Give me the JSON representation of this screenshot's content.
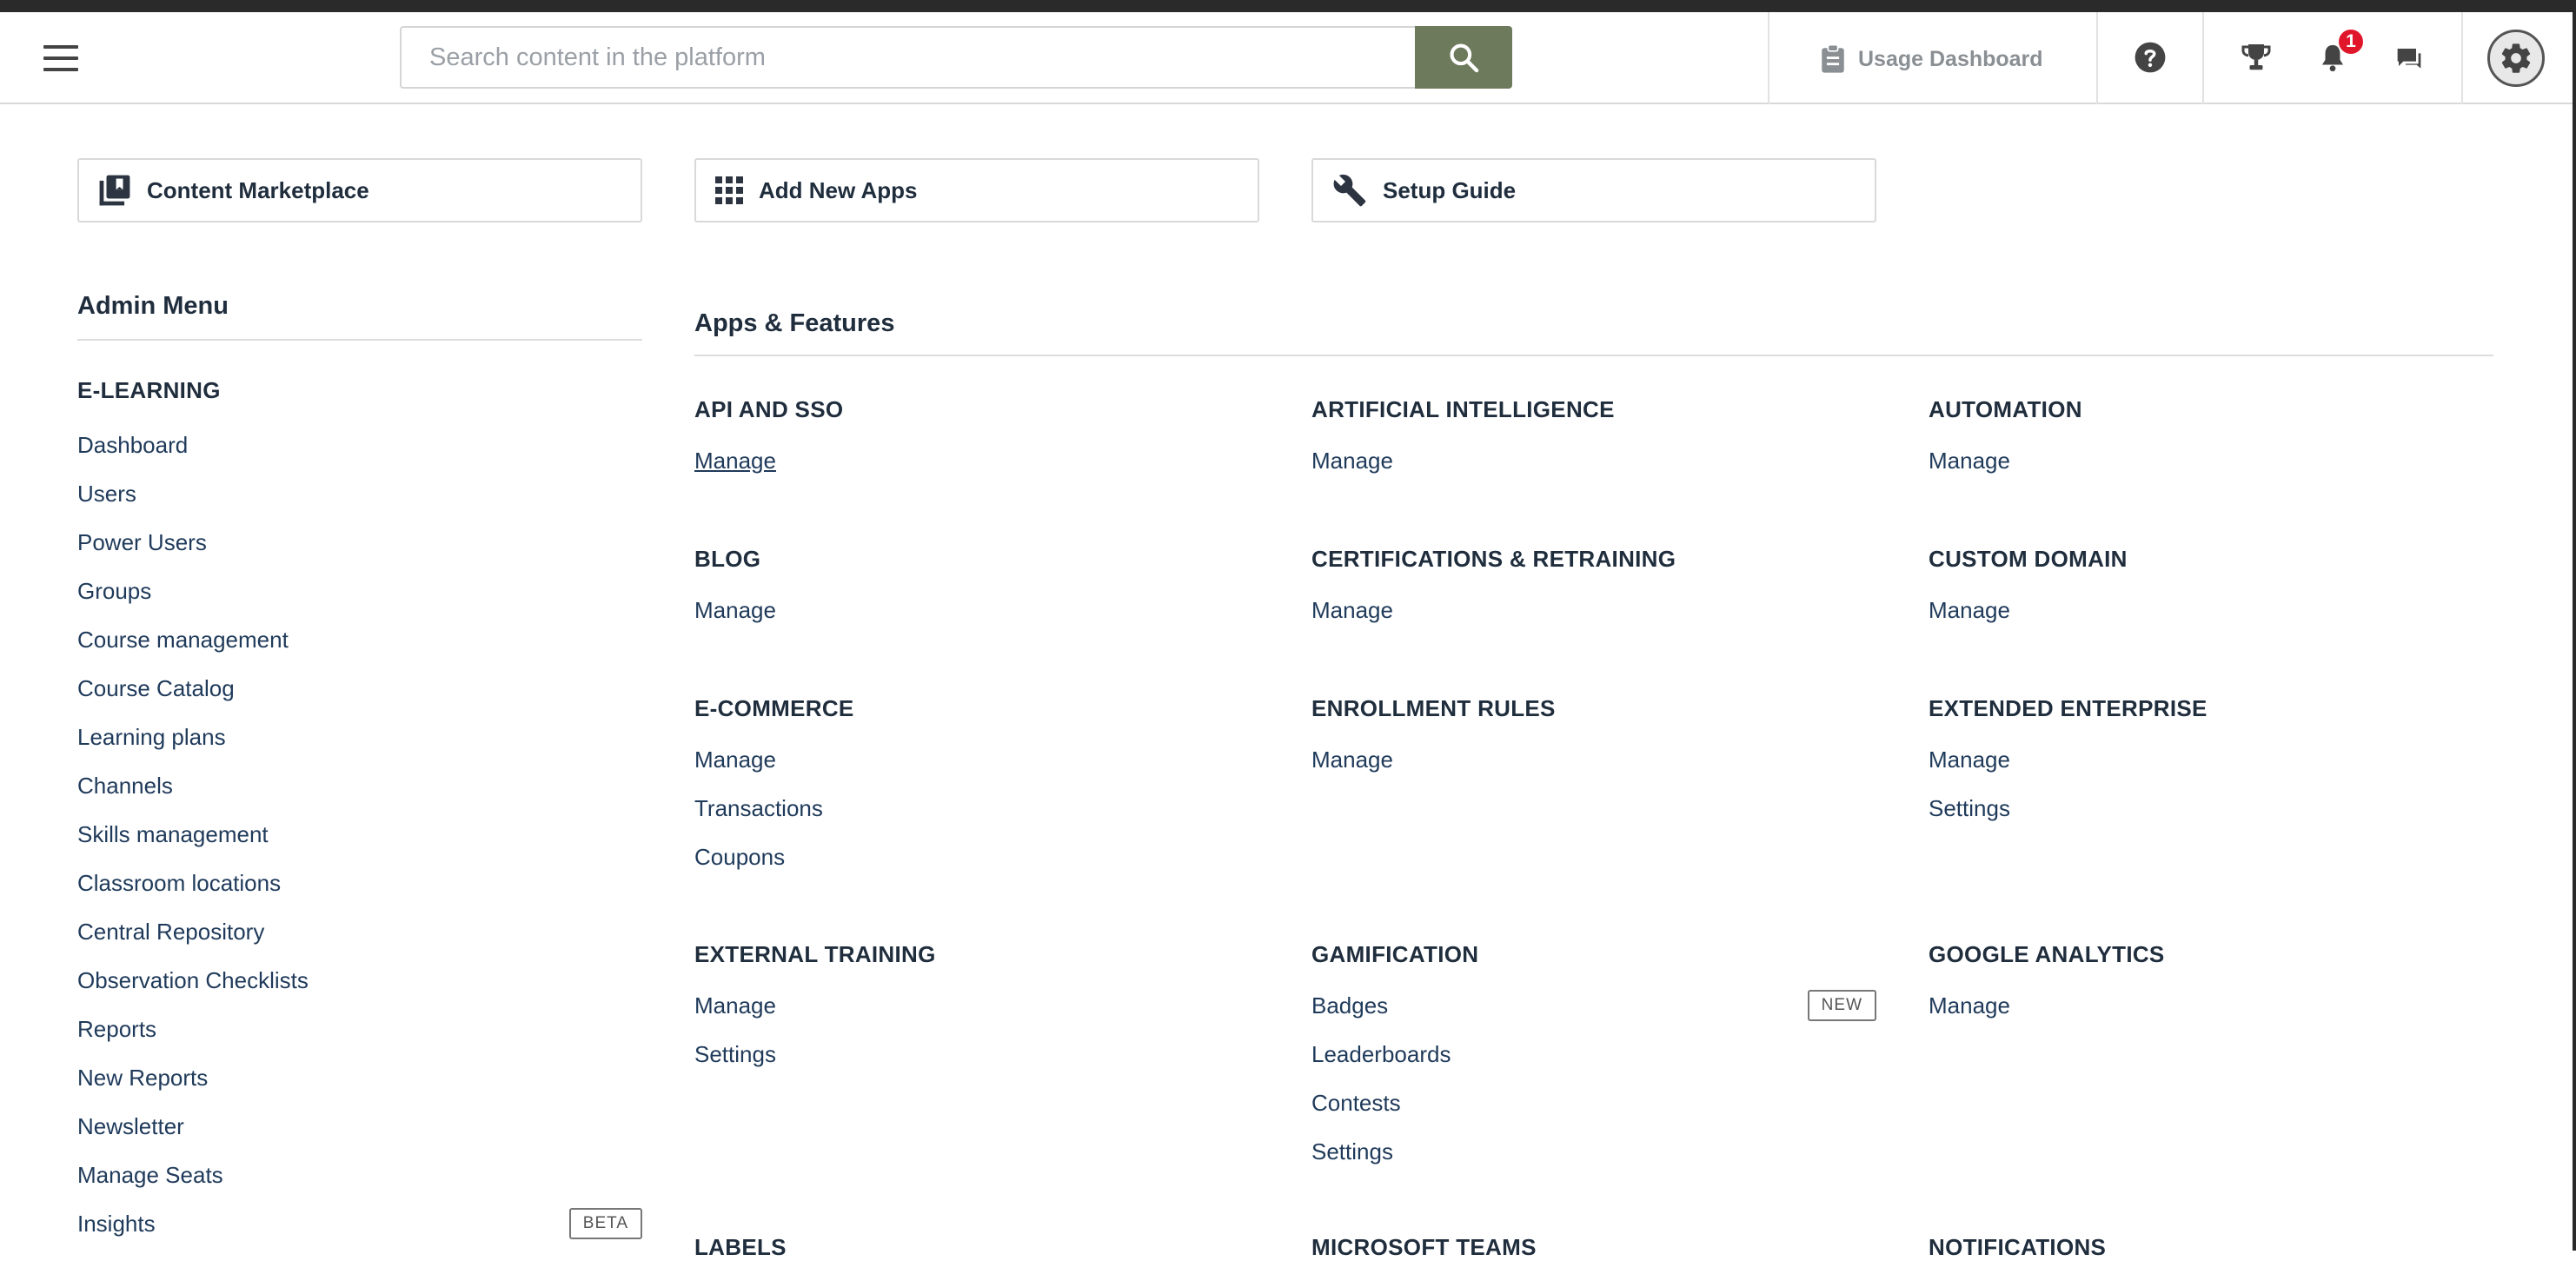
{
  "header": {
    "search": {
      "placeholder": "Search content in the platform",
      "value": ""
    },
    "usage_dashboard": "Usage Dashboard",
    "notification_count": "1"
  },
  "quick_links": [
    {
      "label": "Content Marketplace",
      "icon": "library-icon"
    },
    {
      "label": "Add New Apps",
      "icon": "apps-grid-icon"
    },
    {
      "label": "Setup Guide",
      "icon": "wrench-icon"
    }
  ],
  "admin_menu": {
    "title": "Admin Menu",
    "section": "E-LEARNING",
    "items": [
      {
        "label": "Dashboard"
      },
      {
        "label": "Users"
      },
      {
        "label": "Power Users"
      },
      {
        "label": "Groups"
      },
      {
        "label": "Course management"
      },
      {
        "label": "Course Catalog"
      },
      {
        "label": "Learning plans"
      },
      {
        "label": "Channels"
      },
      {
        "label": "Skills management"
      },
      {
        "label": "Classroom locations"
      },
      {
        "label": "Central Repository"
      },
      {
        "label": "Observation Checklists"
      },
      {
        "label": "Reports"
      },
      {
        "label": "New Reports"
      },
      {
        "label": "Newsletter"
      },
      {
        "label": "Manage Seats"
      },
      {
        "label": "Insights",
        "tag": "BETA"
      }
    ]
  },
  "apps": {
    "title": "Apps & Features",
    "features": [
      {
        "name": "API AND SSO",
        "links": [
          {
            "label": "Manage"
          }
        ]
      },
      {
        "name": "ARTIFICIAL INTELLIGENCE",
        "links": [
          {
            "label": "Manage"
          }
        ]
      },
      {
        "name": "AUTOMATION",
        "links": [
          {
            "label": "Manage"
          }
        ]
      },
      {
        "name": "BLOG",
        "links": [
          {
            "label": "Manage"
          }
        ]
      },
      {
        "name": "CERTIFICATIONS & RETRAINING",
        "links": [
          {
            "label": "Manage"
          }
        ]
      },
      {
        "name": "CUSTOM DOMAIN",
        "links": [
          {
            "label": "Manage"
          }
        ]
      },
      {
        "name": "E-COMMERCE",
        "links": [
          {
            "label": "Manage"
          },
          {
            "label": "Transactions"
          },
          {
            "label": "Coupons"
          }
        ]
      },
      {
        "name": "ENROLLMENT RULES",
        "links": [
          {
            "label": "Manage"
          }
        ]
      },
      {
        "name": "EXTENDED ENTERPRISE",
        "links": [
          {
            "label": "Manage"
          },
          {
            "label": "Settings"
          }
        ]
      },
      {
        "name": "EXTERNAL TRAINING",
        "links": [
          {
            "label": "Manage"
          },
          {
            "label": "Settings"
          }
        ]
      },
      {
        "name": "GAMIFICATION",
        "links": [
          {
            "label": "Badges",
            "tag": "NEW"
          },
          {
            "label": "Leaderboards"
          },
          {
            "label": "Contests"
          },
          {
            "label": "Settings"
          }
        ]
      },
      {
        "name": "GOOGLE ANALYTICS",
        "links": [
          {
            "label": "Manage"
          }
        ]
      }
    ],
    "cut_off": [
      "LABELS",
      "MICROSOFT TEAMS",
      "NOTIFICATIONS"
    ]
  }
}
